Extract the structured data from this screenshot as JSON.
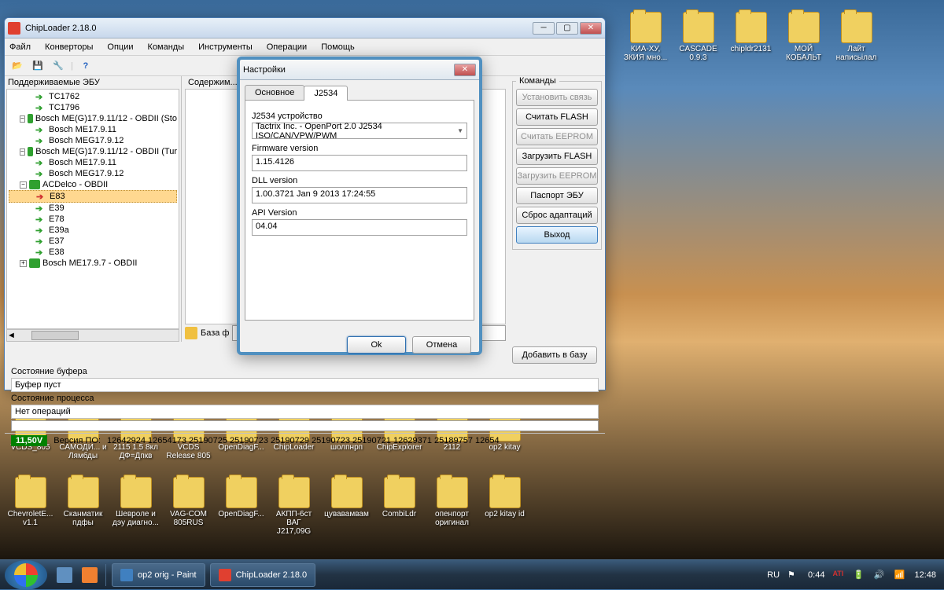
{
  "desktop_icons_top": [
    {
      "label": "КИА-ХУ, ЗКИЯ мно..."
    },
    {
      "label": "CASCADE 0.9.3"
    },
    {
      "label": "chipldr2131"
    },
    {
      "label": "МОЙ КОБАЛЬТ"
    },
    {
      "label": "Лайт написьілал"
    }
  ],
  "desktop_icons_row2": [
    {
      "label": "VCDS_805"
    },
    {
      "label": "САМОДИ... и Лямбды"
    },
    {
      "label": "2115 1.5 8кл ДФ=Дпкв"
    },
    {
      "label": "VCDS Release 805"
    },
    {
      "label": "OpenDiagF..."
    },
    {
      "label": "ChipLoader"
    },
    {
      "label": "шолпнрп"
    },
    {
      "label": "ChipExplorer"
    },
    {
      "label": "2112"
    },
    {
      "label": "op2 kitay"
    }
  ],
  "desktop_icons_row3": [
    {
      "label": "ChevroletE... v1.1"
    },
    {
      "label": "Сканматик пдфы"
    },
    {
      "label": "Шевроле и дэу диагно..."
    },
    {
      "label": "VAG-COM 805RUS"
    },
    {
      "label": "OpenDiagF..."
    },
    {
      "label": "АКПП-6ст ВАГ J217,09G"
    },
    {
      "label": "цувавамвам"
    },
    {
      "label": "CombiLdr"
    },
    {
      "label": "опенпорт оригинал"
    },
    {
      "label": "op2 kitay id"
    }
  ],
  "main_window": {
    "title": "ChipLoader 2.18.0",
    "menus": [
      "Файл",
      "Конверторы",
      "Опции",
      "Команды",
      "Инструменты",
      "Операции",
      "Помощь"
    ],
    "tree_label": "Поддерживаемые ЭБУ",
    "content_label": "Содержим...",
    "tree": [
      {
        "lvl": 2,
        "ico": "arr",
        "text": "TC1762"
      },
      {
        "lvl": 2,
        "ico": "arr",
        "text": "TC1796"
      },
      {
        "lvl": 1,
        "ico": "grn",
        "exp": "−",
        "text": "Bosch ME(G)17.9.11/12 - OBDII (Sto"
      },
      {
        "lvl": 2,
        "ico": "arr",
        "text": "Bosch ME17.9.11"
      },
      {
        "lvl": 2,
        "ico": "arr",
        "text": "Bosch MEG17.9.12"
      },
      {
        "lvl": 1,
        "ico": "grn",
        "exp": "−",
        "text": "Bosch ME(G)17.9.11/12 - OBDII (Tur"
      },
      {
        "lvl": 2,
        "ico": "arr",
        "text": "Bosch ME17.9.11"
      },
      {
        "lvl": 2,
        "ico": "arr",
        "text": "Bosch MEG17.9.12"
      },
      {
        "lvl": 1,
        "ico": "grn",
        "exp": "−",
        "text": "ACDelco - OBDII"
      },
      {
        "lvl": 2,
        "ico": "red",
        "text": "E83",
        "sel": true
      },
      {
        "lvl": 2,
        "ico": "arr",
        "text": "E39"
      },
      {
        "lvl": 2,
        "ico": "arr",
        "text": "E78"
      },
      {
        "lvl": 2,
        "ico": "arr",
        "text": "E39a"
      },
      {
        "lvl": 2,
        "ico": "arr",
        "text": "E37"
      },
      {
        "lvl": 2,
        "ico": "arr",
        "text": "E38"
      },
      {
        "lvl": 1,
        "ico": "grn",
        "exp": "+",
        "text": "Bosch ME17.9.7 - OBDII"
      }
    ],
    "db_label": "База ф",
    "commands": {
      "group_label": "Команды",
      "items": [
        {
          "label": "Установить связь",
          "disabled": true
        },
        {
          "label": "Считать FLASH"
        },
        {
          "label": "Считать EEPROM",
          "disabled": true
        },
        {
          "label": "Загрузить FLASH"
        },
        {
          "label": "Загрузить EEPROM",
          "disabled": true
        },
        {
          "label": "Паспорт ЭБУ"
        },
        {
          "label": "Сброс адаптаций"
        },
        {
          "label": "Выход",
          "hl": true
        }
      ]
    },
    "add_db_label": "Добавить в базу",
    "status": {
      "buf_label": "Состояние буфера",
      "buf_value": "Буфер пуст",
      "proc_label": "Состояние процесса",
      "proc_value": "Нет операций"
    },
    "bottom": {
      "voltage": "11,50V",
      "version_label": "Версия ПО:",
      "version": "12642924 12654173 25190725 25190723 25190729 25190723 25190721 12629371 25189757 12654"
    }
  },
  "dialog": {
    "title": "Настройки",
    "tabs": [
      "Основное",
      "J2534"
    ],
    "active_tab": 1,
    "device_label": "J2534 устройство",
    "device_value": "Tactrix Inc. - OpenPort 2.0 J2534 ISO/CAN/VPW/PWM",
    "fw_label": "Firmware version",
    "fw_value": "1.15.4126",
    "dll_label": "DLL version",
    "dll_value": "1.00.3721 Jan  9 2013 17:24:55",
    "api_label": "API Version",
    "api_value": "04.04",
    "ok": "Ok",
    "cancel": "Отмена"
  },
  "taskbar": {
    "task1": "op2 orig - Paint",
    "task2": "ChipLoader 2.18.0",
    "lang": "RU",
    "time1": "0:44",
    "time2": "12:48"
  }
}
